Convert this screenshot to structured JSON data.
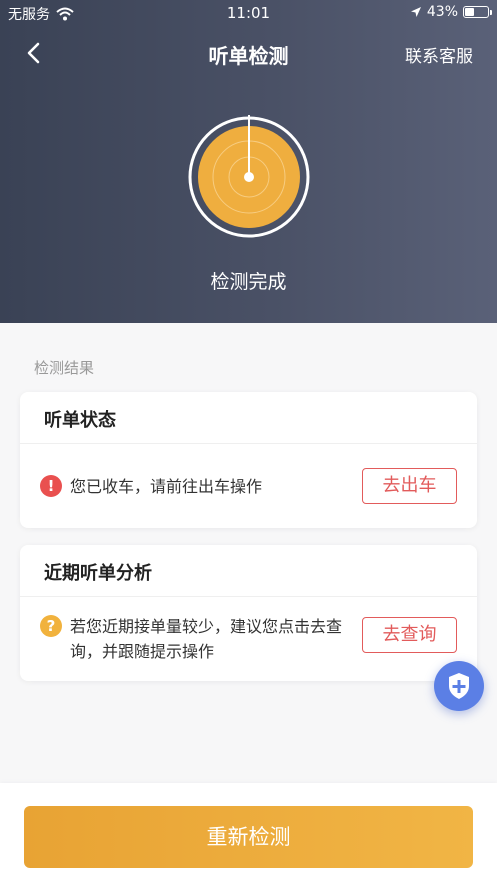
{
  "status_bar": {
    "carrier": "无服务",
    "time": "11:01",
    "battery_percent": "43%",
    "battery_level": 0.43,
    "icons": [
      "wifi-icon",
      "location-arrow-icon",
      "battery-icon"
    ]
  },
  "nav": {
    "title": "听单检测",
    "right_link": "联系客服",
    "back_icon": "chevron-left-icon"
  },
  "header": {
    "status_text": "检测完成",
    "radar_color": "#EFAE3F"
  },
  "results": {
    "section_title": "检测结果",
    "cards": [
      {
        "title": "听单状态",
        "alert_icon": "exclamation-icon",
        "alert_color": "#E9504F",
        "message": "您已收车，请前往出车操作",
        "button": "去出车"
      },
      {
        "title": "近期听单分析",
        "alert_icon": "question-icon",
        "alert_color": "#F1B23D",
        "message": "若您近期接单量较少，建议您点击去查询，并跟随提示操作",
        "button": "去查询"
      }
    ]
  },
  "fab": {
    "icon": "shield-plus-icon"
  },
  "footer": {
    "primary_button": "重新检测"
  },
  "colors": {
    "header_bg": "#434A5E",
    "accent_orange": "#EDAA3B",
    "danger_red": "#E25B5B"
  }
}
